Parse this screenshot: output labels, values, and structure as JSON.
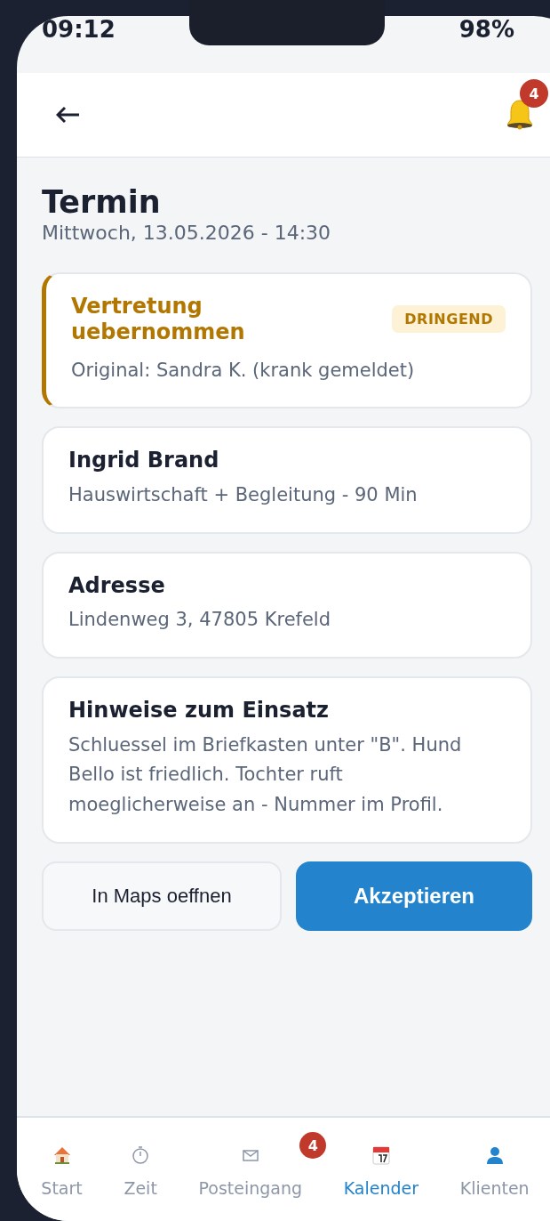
{
  "status_bar": {
    "time": "09:12",
    "battery": "98%"
  },
  "header": {
    "notification_count": "4"
  },
  "title": "Termin",
  "subtitle": "Mittwoch, 13.05.2026 - 14:30",
  "cards": [
    {
      "kind": "alert",
      "title": "Vertretung uebernommen",
      "badge": "DRINGEND",
      "text": "Original: Sandra K. (krank gemeldet)"
    },
    {
      "kind": "info",
      "title": "Ingrid Brand",
      "text": "Hauswirtschaft + Begleitung - 90 Min"
    },
    {
      "kind": "info",
      "title": "Adresse",
      "text": "Lindenweg 3, 47805 Krefeld"
    },
    {
      "kind": "info",
      "title": "Hinweise zum Einsatz",
      "text": "Schluessel im Briefkasten unter \"B\". Hund Bello ist friedlich. Tochter ruft moeglicherweise an - Nummer im Profil."
    }
  ],
  "buttons": [
    {
      "kind": "secondary",
      "label": "In Maps oeffnen"
    },
    {
      "kind": "primary",
      "label": "Akzeptieren"
    }
  ],
  "nav": [
    {
      "kind": "house",
      "label": "Start",
      "selected": false
    },
    {
      "kind": "stopwatch",
      "label": "Zeit",
      "selected": false
    },
    {
      "kind": "envelope",
      "label": "Posteingang",
      "selected": false,
      "badge": "4"
    },
    {
      "kind": "calendar",
      "label": "Kalender",
      "selected": true
    },
    {
      "kind": "person",
      "label": "Klienten",
      "selected": false
    }
  ]
}
